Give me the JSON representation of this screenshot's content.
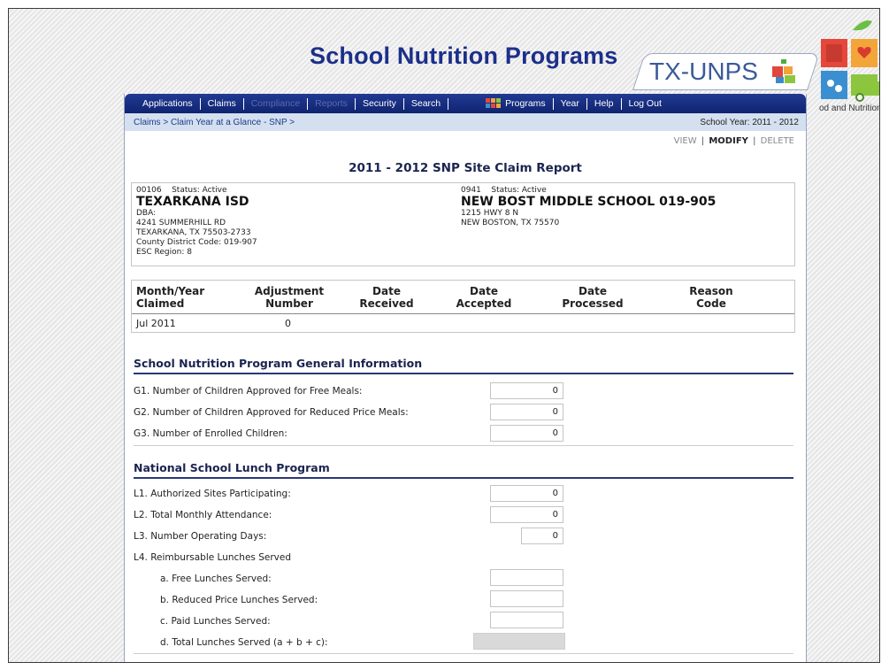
{
  "app": {
    "title": "School Nutrition Programs",
    "brand": "TX-UNPS"
  },
  "side_banner": {
    "text": "od and Nutrition"
  },
  "nav": {
    "items": [
      {
        "label": "Applications",
        "enabled": true
      },
      {
        "label": "Claims",
        "enabled": true
      },
      {
        "label": "Compliance",
        "enabled": false
      },
      {
        "label": "Reports",
        "enabled": false
      },
      {
        "label": "Security",
        "enabled": true
      },
      {
        "label": "Search",
        "enabled": true
      },
      {
        "label": "Programs",
        "enabled": true,
        "icon": "programs-grid-icon"
      },
      {
        "label": "Year",
        "enabled": true
      },
      {
        "label": "Help",
        "enabled": true
      },
      {
        "label": "Log Out",
        "enabled": true
      }
    ]
  },
  "breadcrumb": "Claims > Claim Year at a Glance - SNP >",
  "school_year": "School Year: 2011 - 2012",
  "actions": {
    "view": "VIEW",
    "modify": "MODIFY",
    "delete": "DELETE",
    "active": "MODIFY"
  },
  "report_title": "2011 - 2012 SNP Site Claim Report",
  "sponsor": {
    "id": "00106",
    "status": "Status: Active",
    "name": "TEXARKANA ISD",
    "dba": "DBA:",
    "address1": "4241 SUMMERHILL RD",
    "address2": "TEXARKANA, TX 75503-2733",
    "county": "County District Code: 019-907",
    "esc": "ESC Region: 8"
  },
  "site": {
    "id": "0941",
    "status": "Status: Active",
    "name": "NEW BOST MIDDLE SCHOOL 019-905",
    "address1": "1215 HWY 8 N",
    "address2": "NEW BOSTON, TX 75570"
  },
  "claim": {
    "headers": [
      [
        "Month/Year",
        "Claimed"
      ],
      [
        "Adjustment",
        "Number"
      ],
      [
        "Date",
        "Received"
      ],
      [
        "Date",
        "Accepted"
      ],
      [
        "Date",
        "Processed"
      ],
      [
        "Reason",
        "Code"
      ]
    ],
    "row": {
      "month_year": "Jul 2011",
      "adjustment": "0"
    }
  },
  "general": {
    "title": "School Nutrition Program General Information",
    "rows": [
      {
        "label": "G1.  Number of Children Approved for Free Meals:",
        "value": "0"
      },
      {
        "label": "G2.  Number of Children Approved for Reduced Price Meals:",
        "value": "0"
      },
      {
        "label": "G3.  Number of Enrolled Children:",
        "value": "0"
      }
    ]
  },
  "nslp": {
    "title": "National School Lunch Program",
    "rows": [
      {
        "label": "L1.  Authorized Sites Participating:",
        "value": "0"
      },
      {
        "label": "L2.  Total Monthly Attendance:",
        "value": "0"
      },
      {
        "label": "L3.  Number Operating Days:",
        "value": "0"
      }
    ],
    "l4_label": "L4.  Reimbursable Lunches Served",
    "l4_rows": [
      {
        "label": "a. Free Lunches Served:",
        "value": ""
      },
      {
        "label": "b. Reduced Price Lunches Served:",
        "value": ""
      },
      {
        "label": "c. Paid Lunches Served:",
        "value": ""
      },
      {
        "label": "d. Total Lunches Served (a + b + c):",
        "value": ""
      }
    ]
  },
  "colors": {
    "nav": "#1a3185",
    "title": "#1c2f8a",
    "crumb_bg": "#d4e0f0"
  }
}
